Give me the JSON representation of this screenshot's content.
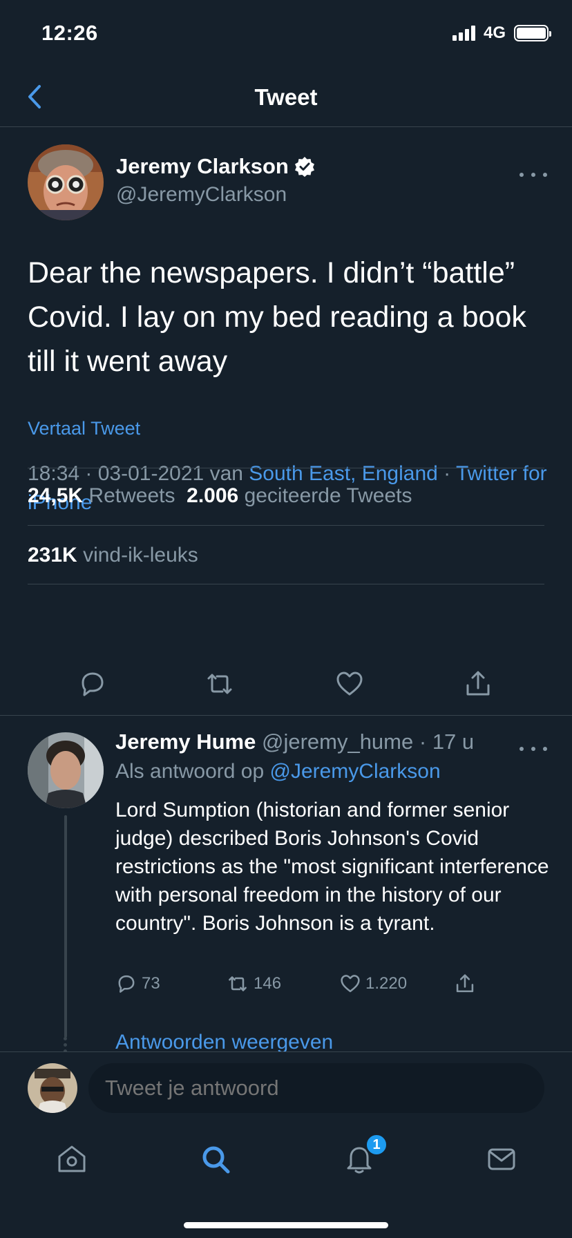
{
  "status_bar": {
    "time": "12:26",
    "network": "4G"
  },
  "nav": {
    "title": "Tweet"
  },
  "tweet": {
    "author_name": "Jeremy Clarkson",
    "author_handle": "@JeremyClarkson",
    "text": "Dear the newspapers. I didn’t “battle” Covid. I lay on my bed reading a book till it went away",
    "translate_label": "Vertaal Tweet",
    "time": "18:34",
    "date": "03-01-2021",
    "via_label": "van",
    "location": "South East, England",
    "source": "Twitter for iPhone",
    "retweets_count": "24,5K",
    "retweets_label": "Retweets",
    "quotes_count": "2.006",
    "quotes_label": "geciteerde Tweets",
    "likes_count": "231K",
    "likes_label": "vind-ik-leuks"
  },
  "reply": {
    "author_name": "Jeremy Hume",
    "author_handle": "@jeremy_hume",
    "age": "17 u",
    "reply_to_label": "Als antwoord op",
    "reply_to_handle": "@JeremyClarkson",
    "text": "Lord Sumption (historian and former senior judge) described Boris Johnson's Covid restrictions as the \"most significant interference with personal freedom in the history of our country\". Boris Johnson is a tyrant.",
    "replies": "73",
    "retweets": "146",
    "likes": "1.220",
    "show_replies_label": "Antwoorden weergeven"
  },
  "composer": {
    "placeholder": "Tweet je antwoord"
  },
  "tab_bar": {
    "items": [
      "home-icon",
      "search-icon",
      "notifications-icon",
      "messages-icon"
    ],
    "active": "search-icon",
    "notification_badge": "1"
  },
  "colors": {
    "background": "#15202b",
    "accent": "#4a99e9",
    "muted": "#8899a6",
    "divider": "#38444d"
  }
}
